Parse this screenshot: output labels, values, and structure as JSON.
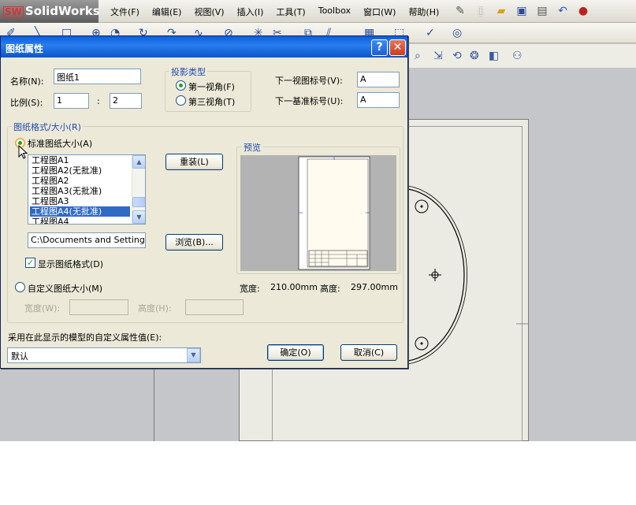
{
  "app": {
    "logo_text": "SolidWorks",
    "logo_mark": "SW",
    "menu": [
      "文件(F)",
      "编辑(E)",
      "视图(V)",
      "插入(I)",
      "工具(T)",
      "Toolbox",
      "窗口(W)",
      "帮助(H)"
    ]
  },
  "dialog": {
    "title": "图纸属性",
    "help_label": "?",
    "close_label": "✕",
    "name_label": "名称(N):",
    "name_value": "图纸1",
    "scale_label": "比例(S):",
    "scale_left": "1",
    "scale_sep": ":",
    "scale_right": "2",
    "projection": {
      "title": "投影类型",
      "first_angle": "第一视角(F)",
      "third_angle": "第三视角(T)",
      "selected": "first_angle"
    },
    "next_view_label": "下一视图标号(V):",
    "next_view_value": "A",
    "next_datum_label": "下一基准标号(U):",
    "next_datum_value": "A",
    "format_group_title": "图纸格式/大小(R)",
    "standard_size_label": "标准图纸大小(A)",
    "sheet_list": [
      "工程图A1",
      "工程图A2(无批准)",
      "工程图A2",
      "工程图A3(无批准)",
      "工程图A3",
      "工程图A4(无批准)",
      "工程图A4"
    ],
    "selected_sheet": "工程图A4(无批准)",
    "reload_button": "重装(L)",
    "path_value": "C:\\Documents and Settings\\Al",
    "browse_button": "浏览(B)...",
    "show_format_label": "显示图纸格式(D)",
    "show_format_checked": true,
    "preview_title": "预览",
    "width_label": "宽度:",
    "width_value": "210.00mm",
    "height_label": "高度:",
    "height_value": "297.00mm",
    "custom_size_label": "自定义图纸大小(M)",
    "custom_width_label": "宽度(W):",
    "custom_height_label": "高度(H):",
    "custom_width_value": "",
    "custom_height_value": "",
    "model_props_label": "采用在此显示的模型的自定义属性值(E):",
    "model_props_value": "默认",
    "ok_button": "确定(O)",
    "cancel_button": "取消(C)"
  }
}
